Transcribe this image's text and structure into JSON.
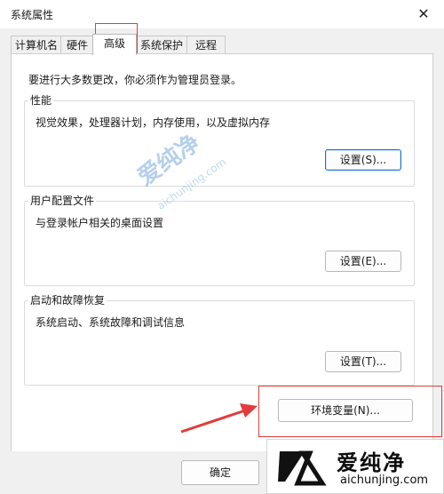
{
  "window": {
    "title": "系统属性",
    "close_glyph": "✕"
  },
  "tabs": [
    {
      "label": "计算机名",
      "active": false
    },
    {
      "label": "硬件",
      "active": false
    },
    {
      "label": "高级",
      "active": true
    },
    {
      "label": "系统保护",
      "active": false
    },
    {
      "label": "远程",
      "active": false
    }
  ],
  "notice": "要进行大多数更改，你必须作为管理员登录。",
  "groups": {
    "performance": {
      "label": "性能",
      "desc": "视觉效果，处理器计划，内存使用，以及虚拟内存",
      "button": "设置(S)..."
    },
    "user_profiles": {
      "label": "用户配置文件",
      "desc": "与登录帐户相关的桌面设置",
      "button": "设置(E)..."
    },
    "startup_recovery": {
      "label": "启动和故障恢复",
      "desc": "系统启动、系统故障和调试信息",
      "button": "设置(T)..."
    }
  },
  "env_button": "环境变量(N)...",
  "ok_button": "确定",
  "watermark": {
    "text": "爱纯净",
    "url": "aichunjing.com"
  },
  "logo": {
    "text": "爱纯净",
    "url": "aichunjing.com"
  },
  "colors": {
    "annotation_red": "#e33b3b",
    "focus_blue": "#1a73c8"
  },
  "icons": {
    "close": "close-icon",
    "arrow": "red-arrow-icon",
    "logo": "aichunjing-logo-icon"
  }
}
